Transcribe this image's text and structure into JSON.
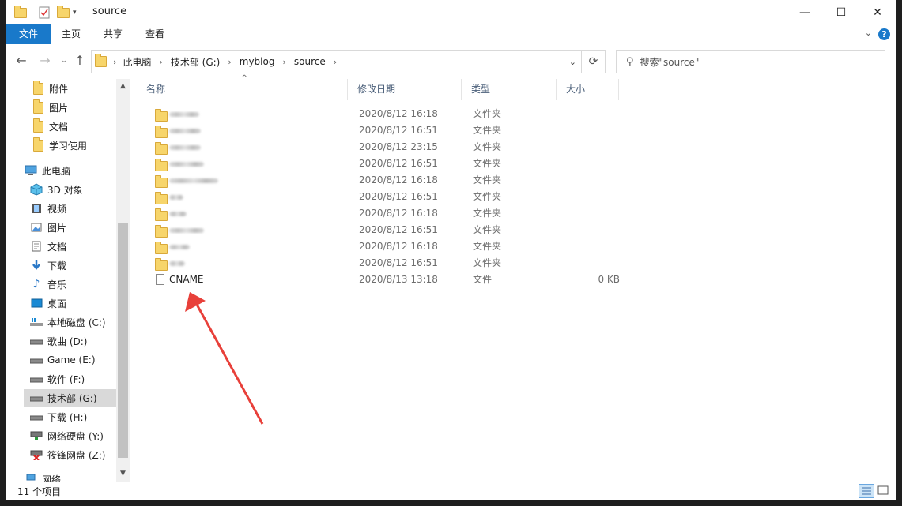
{
  "window": {
    "title": "source",
    "controls": {
      "minimize": "—",
      "maximize": "☐",
      "close": "✕"
    }
  },
  "ribbon": {
    "tabs": [
      {
        "label": "文件"
      },
      {
        "label": "主页"
      },
      {
        "label": "共享"
      },
      {
        "label": "查看"
      }
    ],
    "help": "?"
  },
  "address": {
    "crumbs": [
      "此电脑",
      "技术部 (G:)",
      "myblog",
      "source"
    ]
  },
  "search": {
    "placeholder": "搜索\"source\""
  },
  "sidebar": {
    "items": [
      {
        "label": "附件",
        "icon": "folder-icon"
      },
      {
        "label": "图片",
        "icon": "folder-icon"
      },
      {
        "label": "文档",
        "icon": "folder-icon"
      },
      {
        "label": "学习使用",
        "icon": "folder-icon"
      },
      {
        "label": "此电脑",
        "icon": "computer-icon"
      },
      {
        "label": "3D 对象",
        "icon": "cube-icon"
      },
      {
        "label": "视频",
        "icon": "video-icon"
      },
      {
        "label": "图片",
        "icon": "picture-icon"
      },
      {
        "label": "文档",
        "icon": "document-icon"
      },
      {
        "label": "下载",
        "icon": "download-icon"
      },
      {
        "label": "音乐",
        "icon": "music-icon"
      },
      {
        "label": "桌面",
        "icon": "desktop-icon"
      },
      {
        "label": "本地磁盘 (C:)",
        "icon": "windows-drive-icon"
      },
      {
        "label": "歌曲 (D:)",
        "icon": "drive-icon"
      },
      {
        "label": "Game (E:)",
        "icon": "drive-icon"
      },
      {
        "label": "软件 (F:)",
        "icon": "drive-icon"
      },
      {
        "label": "技术部 (G:)",
        "icon": "drive-icon"
      },
      {
        "label": "下载 (H:)",
        "icon": "drive-icon"
      },
      {
        "label": "网络硬盘 (Y:)",
        "icon": "network-drive-icon"
      },
      {
        "label": "筱锋网盘 (Z:)",
        "icon": "network-drive-disconnected-icon"
      },
      {
        "label": "网络",
        "icon": "network-icon"
      }
    ],
    "selected": "技术部 (G:)"
  },
  "columns": {
    "name": "名称",
    "modified": "修改日期",
    "type": "类型",
    "size": "大小"
  },
  "files": [
    {
      "name": "",
      "modified": "2020/8/12 16:18",
      "type": "文件夹",
      "size": "",
      "icon": "folder-icon"
    },
    {
      "name": "",
      "modified": "2020/8/12 16:51",
      "type": "文件夹",
      "size": "",
      "icon": "folder-icon"
    },
    {
      "name": "",
      "modified": "2020/8/12 23:15",
      "type": "文件夹",
      "size": "",
      "icon": "folder-icon"
    },
    {
      "name": "",
      "modified": "2020/8/12 16:51",
      "type": "文件夹",
      "size": "",
      "icon": "folder-icon"
    },
    {
      "name": "",
      "modified": "2020/8/12 16:18",
      "type": "文件夹",
      "size": "",
      "icon": "folder-icon"
    },
    {
      "name": "",
      "modified": "2020/8/12 16:51",
      "type": "文件夹",
      "size": "",
      "icon": "folder-icon"
    },
    {
      "name": "",
      "modified": "2020/8/12 16:18",
      "type": "文件夹",
      "size": "",
      "icon": "folder-icon"
    },
    {
      "name": "",
      "modified": "2020/8/12 16:51",
      "type": "文件夹",
      "size": "",
      "icon": "folder-icon"
    },
    {
      "name": "",
      "modified": "2020/8/12 16:18",
      "type": "文件夹",
      "size": "",
      "icon": "folder-icon"
    },
    {
      "name": "",
      "modified": "2020/8/12 16:51",
      "type": "文件夹",
      "size": "",
      "icon": "folder-icon"
    },
    {
      "name": "CNAME",
      "modified": "2020/8/13 13:18",
      "type": "文件",
      "size": "0 KB",
      "icon": "file-icon"
    }
  ],
  "status": {
    "item_count": "11 个项目"
  },
  "colors": {
    "accent": "#1979ca",
    "annotation_arrow": "#e8403a",
    "header_text": "#4c607a"
  }
}
